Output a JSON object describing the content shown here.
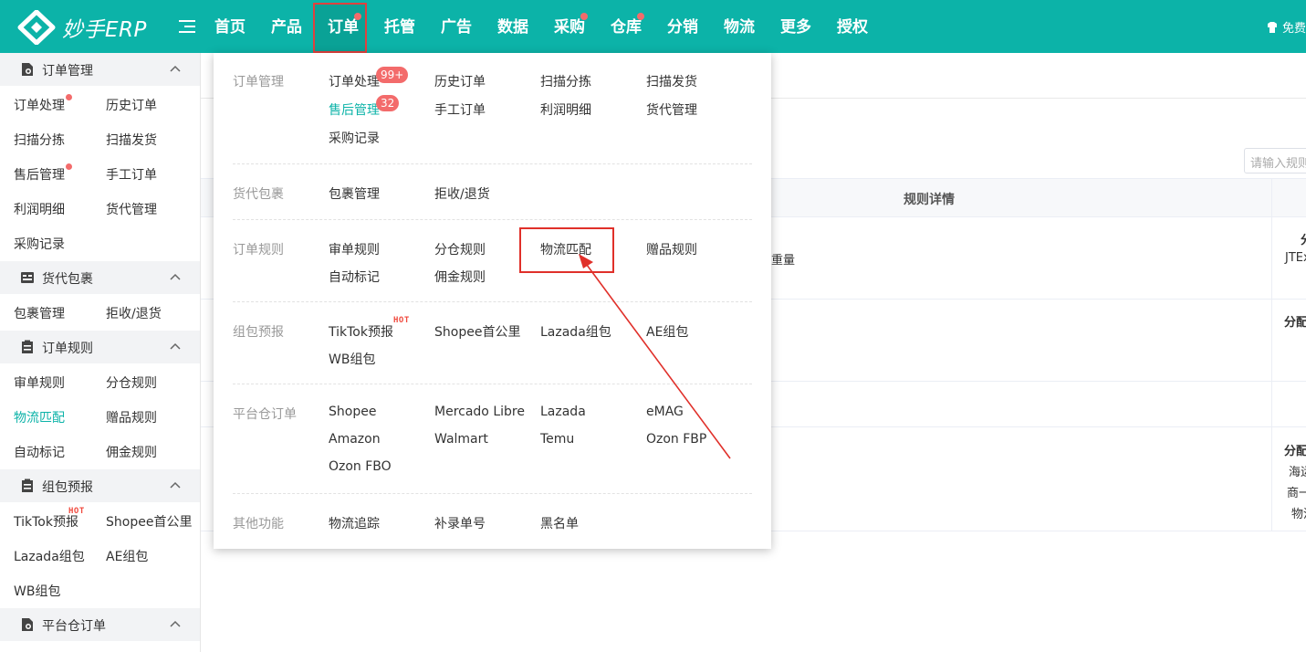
{
  "brand": {
    "name": "妙手ERP"
  },
  "topnav": {
    "items": [
      {
        "label": "首页"
      },
      {
        "label": "产品"
      },
      {
        "label": "订单"
      },
      {
        "label": "托管"
      },
      {
        "label": "广告"
      },
      {
        "label": "数据"
      },
      {
        "label": "采购"
      },
      {
        "label": "仓库"
      },
      {
        "label": "分销"
      },
      {
        "label": "物流"
      },
      {
        "label": "更多"
      },
      {
        "label": "授权"
      }
    ],
    "active": "订单",
    "right_label": "免费"
  },
  "sidebar": {
    "sections": [
      {
        "title": "订单管理",
        "icon": "order-doc-icon",
        "items": [
          "订单处理",
          "历史订单",
          "扫描分拣",
          "扫描发货",
          "售后管理",
          "手工订单",
          "利润明细",
          "货代管理",
          "采购记录"
        ]
      },
      {
        "title": "货代包裹",
        "icon": "truck-icon",
        "items": [
          "包裹管理",
          "拒收/退货"
        ]
      },
      {
        "title": "订单规则",
        "icon": "clipboard-icon",
        "items": [
          "审单规则",
          "分仓规则",
          "物流匹配",
          "赠品规则",
          "自动标记",
          "佣金规则"
        ]
      },
      {
        "title": "组包预报",
        "icon": "clipboard-icon",
        "items": [
          "TikTok预报",
          "Shopee首公里",
          "Lazada组包",
          "AE组包",
          "WB组包"
        ]
      },
      {
        "title": "平台仓订单",
        "icon": "order-doc-icon",
        "items": []
      }
    ],
    "active_item": "物流匹配",
    "hot_label": "HOT"
  },
  "content": {
    "search_placeholder": "请输入规则",
    "table_header": "规则详情",
    "row1_text": "重量",
    "row1_right_a": "分",
    "row1_right_b": "JTEx",
    "row2_right": "分配",
    "row4_right_a": "分配",
    "row4_right_b": "海运",
    "row4_right_c": "商一",
    "row4_right_d": "物流"
  },
  "dropdown": {
    "groups": [
      {
        "category": "订单管理",
        "links": [
          "订单处理",
          "历史订单",
          "扫描分拣",
          "扫描发货",
          "售后管理",
          "手工订单",
          "利润明细",
          "货代管理",
          "采购记录"
        ]
      },
      {
        "category": "货代包裹",
        "links": [
          "包裹管理",
          "拒收/退货"
        ]
      },
      {
        "category": "订单规则",
        "links": [
          "审单规则",
          "分仓规则",
          "物流匹配",
          "赠品规则",
          "自动标记",
          "佣金规则"
        ]
      },
      {
        "category": "组包预报",
        "links": [
          "TikTok预报",
          "Shopee首公里",
          "Lazada组包",
          "AE组包",
          "WB组包"
        ]
      },
      {
        "category": "平台仓订单",
        "links": [
          "Shopee",
          "Mercado Libre",
          "Lazada",
          "eMAG",
          "Amazon",
          "Walmart",
          "Temu",
          "Ozon FBP",
          "Ozon FBO"
        ]
      },
      {
        "category": "其他功能",
        "links": [
          "物流追踪",
          "补录单号",
          "黑名单"
        ]
      }
    ],
    "badges": {
      "order_processing": "99+",
      "after_sales": "32"
    },
    "hot_label": "HOT",
    "active_link": "售后管理",
    "highlighted_link": "物流匹配"
  },
  "colors": {
    "brand": "#0cb3a8",
    "badge": "#f36b6b",
    "annotation": "#e0302a"
  }
}
